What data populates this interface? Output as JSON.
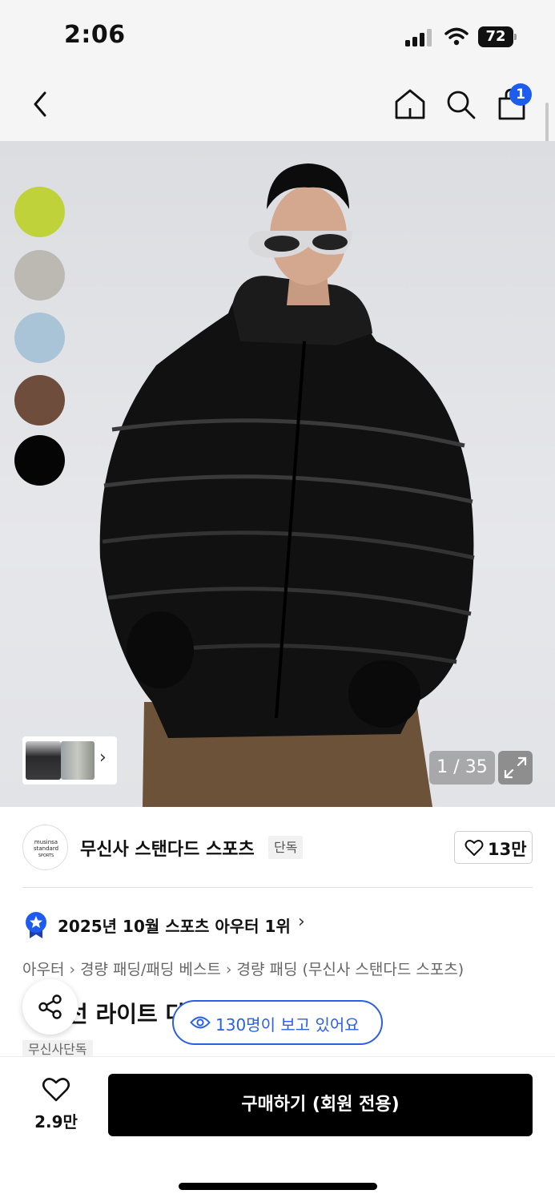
{
  "status_bar": {
    "time": "2:06",
    "battery": "72"
  },
  "nav": {
    "back_icon": "chevron-left-icon",
    "home_icon": "home-icon",
    "search_icon": "search-icon",
    "cart_icon": "shopping-bag-icon",
    "cart_count": "1"
  },
  "gallery": {
    "color_swatches": [
      {
        "name": "lime",
        "color": "#bfd23a"
      },
      {
        "name": "light-gray",
        "color": "#bcb9b3"
      },
      {
        "name": "light-blue",
        "color": "#a9c3d7"
      },
      {
        "name": "brown",
        "color": "#6f4d3c"
      },
      {
        "name": "black",
        "color": "#050505"
      }
    ],
    "page_counter": "1 / 35",
    "thumb_arrow": "›"
  },
  "brand": {
    "logo_lines": [
      "musinsa",
      "standard",
      "SPORTS"
    ],
    "name": "무신사 스탠다드 스포츠",
    "tag": "단독",
    "likes": "13만"
  },
  "ranking": {
    "text": "2025년 10월 스포츠 아우터 1위",
    "arrow": "›"
  },
  "breadcrumb": [
    "아우터",
    "경량 패딩/패딩 베스트",
    "경량 패딩 (무신사 스탠다드 스포츠)"
  ],
  "product": {
    "title": "선 라이트 다",
    "viewers": "130명이 보고 있어요",
    "exclusive_tag": "무신사단독"
  },
  "bottom_bar": {
    "wish_count": "2.9만",
    "buy_label": "구매하기 (회원 전용)"
  },
  "colors": {
    "accent_blue": "#1e5bf0",
    "buy_button": "#000000"
  }
}
